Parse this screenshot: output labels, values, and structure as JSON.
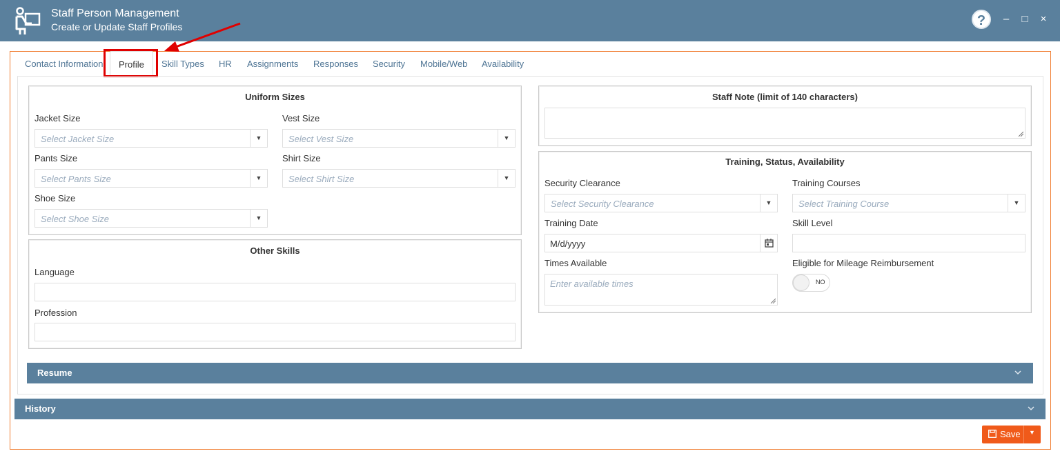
{
  "window": {
    "title": "Staff Person Management",
    "subtitle": "Create or Update Staff Profiles",
    "help_icon": "?",
    "minimize_icon": "–",
    "maximize_icon": "□",
    "close_icon": "×"
  },
  "tabs": [
    {
      "label": "Contact Information"
    },
    {
      "label": "Profile",
      "active": true
    },
    {
      "label": "Skill Types"
    },
    {
      "label": "HR"
    },
    {
      "label": "Assignments"
    },
    {
      "label": "Responses"
    },
    {
      "label": "Security"
    },
    {
      "label": "Mobile/Web"
    },
    {
      "label": "Availability"
    }
  ],
  "uniform": {
    "legend": "Uniform Sizes",
    "jacket": {
      "label": "Jacket Size",
      "placeholder": "Select Jacket Size"
    },
    "vest": {
      "label": "Vest Size",
      "placeholder": "Select Vest Size"
    },
    "pants": {
      "label": "Pants Size",
      "placeholder": "Select Pants Size"
    },
    "shirt": {
      "label": "Shirt Size",
      "placeholder": "Select Shirt Size"
    },
    "shoe": {
      "label": "Shoe Size",
      "placeholder": "Select Shoe Size"
    }
  },
  "other_skills": {
    "legend": "Other Skills",
    "language_label": "Language",
    "profession_label": "Profession"
  },
  "staff_note": {
    "legend": "Staff Note (limit of 140 characters)"
  },
  "training": {
    "legend": "Training, Status, Availability",
    "security": {
      "label": "Security Clearance",
      "placeholder": "Select Security Clearance"
    },
    "courses": {
      "label": "Training Courses",
      "placeholder": "Select Training Course"
    },
    "date": {
      "label": "Training Date",
      "value": "M/d/yyyy"
    },
    "skill_level_label": "Skill Level",
    "times": {
      "label": "Times Available",
      "placeholder": "Enter available times"
    },
    "mileage": {
      "label": "Eligible for Mileage Reimbursement",
      "toggle_text": "NO"
    }
  },
  "panels": {
    "resume": "Resume",
    "history": "History"
  },
  "save": {
    "label": "Save"
  },
  "colors": {
    "header": "#5a809d",
    "accent_orange": "#f05a1a",
    "tab_text": "#4e7494",
    "highlight_red": "#e00000"
  }
}
